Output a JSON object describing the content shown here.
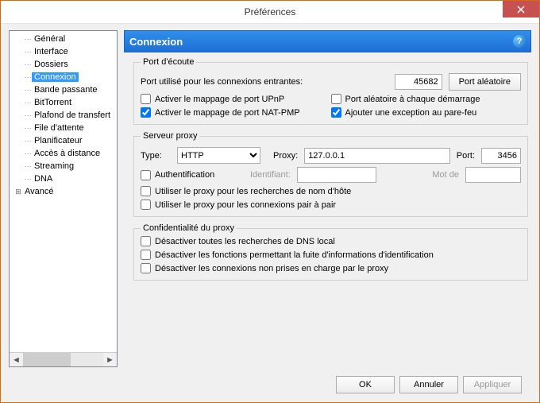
{
  "title": "Préférences",
  "sidebar": {
    "items": [
      {
        "label": "Général",
        "selected": false
      },
      {
        "label": "Interface",
        "selected": false
      },
      {
        "label": "Dossiers",
        "selected": false
      },
      {
        "label": "Connexion",
        "selected": true
      },
      {
        "label": "Bande passante",
        "selected": false
      },
      {
        "label": "BitTorrent",
        "selected": false
      },
      {
        "label": "Plafond de transfert",
        "selected": false
      },
      {
        "label": "File d'attente",
        "selected": false
      },
      {
        "label": "Planificateur",
        "selected": false
      },
      {
        "label": "Accès à distance",
        "selected": false
      },
      {
        "label": "Streaming",
        "selected": false
      },
      {
        "label": "DNA",
        "selected": false
      }
    ],
    "advanced_label": "Avancé"
  },
  "header": {
    "title": "Connexion",
    "help": "?"
  },
  "listening": {
    "legend": "Port d'écoute",
    "port_label": "Port utilisé pour les connexions entrantes:",
    "port_value": "45682",
    "random_btn": "Port aléatoire",
    "chk_upnp": "Activer le mappage de port UPnP",
    "chk_random_start": "Port aléatoire à chaque démarrage",
    "chk_natpmp": "Activer le mappage de port NAT-PMP",
    "chk_firewall": "Ajouter une exception au pare-feu",
    "val_upnp": false,
    "val_random_start": false,
    "val_natpmp": true,
    "val_firewall": true
  },
  "proxy": {
    "legend": "Serveur proxy",
    "type_label": "Type:",
    "type_value": "HTTP",
    "type_options": [
      "HTTP"
    ],
    "proxy_label": "Proxy:",
    "proxy_value": "127.0.0.1",
    "port_label": "Port:",
    "port_value": "3456",
    "chk_auth": "Authentification",
    "ident_label": "Identifiant:",
    "ident_value": "",
    "pass_label": "Mot de",
    "pass_value": "",
    "chk_hostlookup": "Utiliser le proxy pour les recherches de nom d'hôte",
    "chk_p2p": "Utiliser le proxy pour les connexions pair à pair",
    "val_auth": false,
    "val_hostlookup": false,
    "val_p2p": false
  },
  "privacy": {
    "legend": "Confidentialité du proxy",
    "chk_dns": "Désactiver toutes les recherches de DNS local",
    "chk_leak": "Désactiver les fonctions permettant la fuite d'informations d'identification",
    "chk_unsupported": "Désactiver les connexions non prises en charge par le proxy",
    "val_dns": false,
    "val_leak": false,
    "val_unsupported": false
  },
  "buttons": {
    "ok": "OK",
    "cancel": "Annuler",
    "apply": "Appliquer"
  }
}
